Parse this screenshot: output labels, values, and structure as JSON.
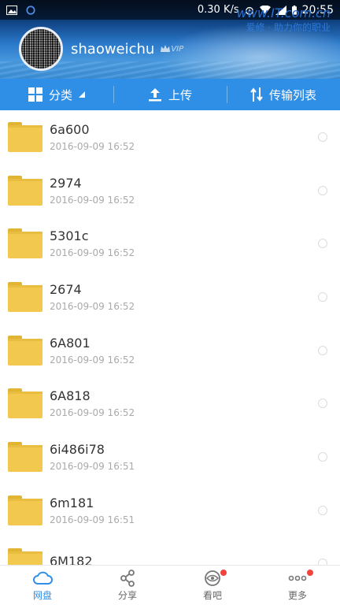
{
  "status_bar": {
    "speed": "0.30 K/s",
    "time": "20:55"
  },
  "watermark": {
    "line1": "www.IT.com.cn",
    "line2": "爱修 · 助力你的职业"
  },
  "profile": {
    "username": "shaoweichu",
    "badge": "VIP"
  },
  "actions": [
    {
      "label": "分类",
      "icon": "grid-icon"
    },
    {
      "label": "上传",
      "icon": "upload-icon"
    },
    {
      "label": "传输列表",
      "icon": "transfer-icon"
    }
  ],
  "files": [
    {
      "name": "6a600",
      "date": "2016-09-09 16:52"
    },
    {
      "name": "2974",
      "date": "2016-09-09 16:52"
    },
    {
      "name": "5301c",
      "date": "2016-09-09 16:52"
    },
    {
      "name": "2674",
      "date": "2016-09-09 16:52"
    },
    {
      "name": "6A801",
      "date": "2016-09-09 16:52"
    },
    {
      "name": "6A818",
      "date": "2016-09-09 16:52"
    },
    {
      "name": "6i486i78",
      "date": "2016-09-09 16:51"
    },
    {
      "name": "6m181",
      "date": "2016-09-09 16:51"
    },
    {
      "name": "6M182",
      "date": ""
    }
  ],
  "nav": [
    {
      "label": "网盘",
      "icon": "cloud-icon",
      "active": true
    },
    {
      "label": "分享",
      "icon": "share-icon",
      "active": false
    },
    {
      "label": "看吧",
      "icon": "eye-icon",
      "active": false,
      "dot": true
    },
    {
      "label": "更多",
      "icon": "more-icon",
      "active": false,
      "dot": true
    }
  ],
  "colors": {
    "accent": "#2f8ee5",
    "folder": "#f3c84e",
    "dot": "#f0443c"
  }
}
